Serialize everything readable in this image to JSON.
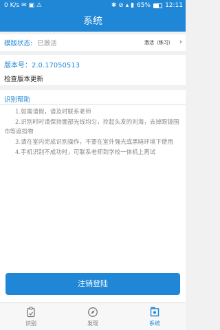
{
  "statusbar": {
    "left": "0 K/s ✉ ▣ ⚠",
    "signal": "✱ ⊘ ▴ ▮",
    "battery": "65%",
    "time": "12:11"
  },
  "header": {
    "title": "系统"
  },
  "mode": {
    "label": "模版状态:",
    "value": "已激活",
    "right": "激活（练习）"
  },
  "version": {
    "label": "版本号：2.0.17050513",
    "check": "检查版本更新"
  },
  "help": {
    "title": "识别帮助",
    "items": [
      "1.如需请假，请及时联系老师",
      "2.识别时时请保持面部光线均匀，拎起头发的刘海，去掉眼镜围巾等遮挡物",
      "3.请在室内完成识别操作，不要在室外强光或黑暗环境下使用",
      "4.手机识别不成功时，可联系老师到学校一体机上再试"
    ]
  },
  "logout_label": "注销登陆",
  "tabs": [
    {
      "label": "识别",
      "icon": "recognize-icon",
      "active": false
    },
    {
      "label": "发现",
      "icon": "discover-icon",
      "active": false
    },
    {
      "label": "系统",
      "icon": "system-icon",
      "active": true
    }
  ],
  "colors": {
    "primary": "#1f87d6",
    "background": "#f1f1f1"
  }
}
